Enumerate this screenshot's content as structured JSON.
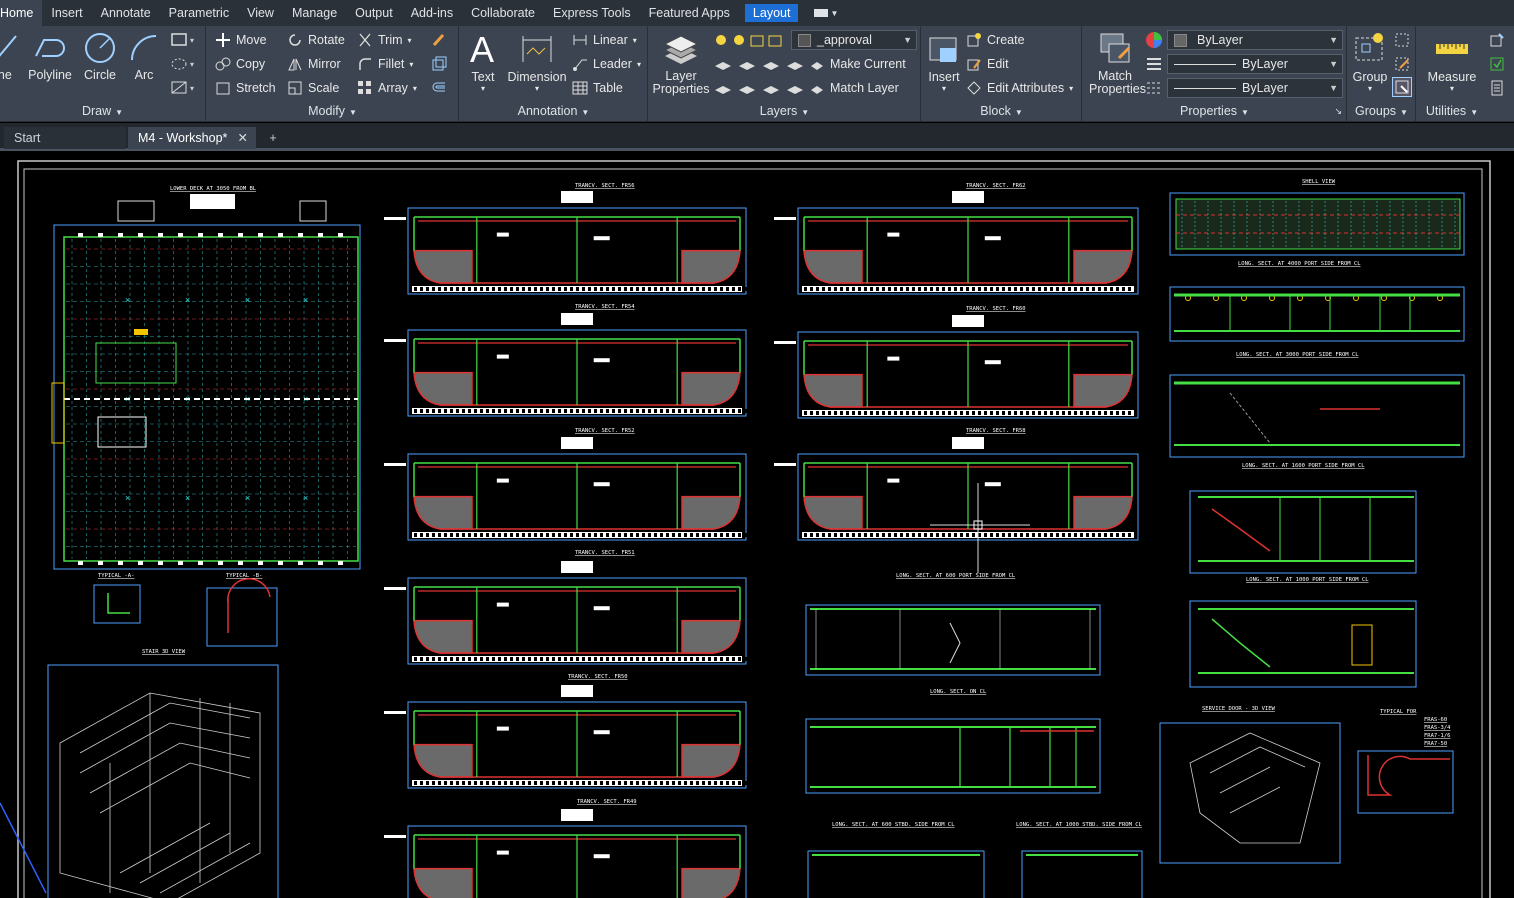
{
  "menu": {
    "tabs": [
      "Home",
      "Insert",
      "Annotate",
      "Parametric",
      "View",
      "Manage",
      "Output",
      "Add-ins",
      "Collaborate",
      "Express Tools",
      "Featured Apps",
      "Layout"
    ]
  },
  "ribbon": {
    "draw": {
      "title": "Draw",
      "line": "Line",
      "polyline": "Polyline",
      "circle": "Circle",
      "arc": "Arc"
    },
    "modify": {
      "title": "Modify",
      "move": "Move",
      "rotate": "Rotate",
      "trim": "Trim",
      "copy": "Copy",
      "mirror": "Mirror",
      "fillet": "Fillet",
      "stretch": "Stretch",
      "scale": "Scale",
      "array": "Array"
    },
    "annotation": {
      "title": "Annotation",
      "text": "Text",
      "dimension": "Dimension",
      "linear": "Linear",
      "leader": "Leader",
      "table": "Table"
    },
    "layers": {
      "title": "Layers",
      "layer_properties": "Layer Properties",
      "current_layer": "_approval",
      "make_current": "Make Current",
      "match_layer": "Match Layer"
    },
    "block": {
      "title": "Block",
      "insert": "Insert",
      "create": "Create",
      "edit": "Edit",
      "edit_attributes": "Edit Attributes"
    },
    "properties": {
      "title": "Properties",
      "match_properties": "Match Properties",
      "color": "ByLayer",
      "linetype": "ByLayer",
      "lineweight": "ByLayer"
    },
    "groups": {
      "title": "Groups",
      "group": "Group"
    },
    "utilities": {
      "title": "Utilities",
      "measure": "Measure"
    }
  },
  "file_tabs": {
    "start": "Start",
    "active": "M4 - Workshop*"
  },
  "drawing": {
    "titles": {
      "lower_deck": "LOWER DECK AT 3050 FROM BL",
      "fr56": "TRANCV. SECT. FR56",
      "fr62": "TRANCV. SECT. FR62",
      "shell_view": "SHELL VIEW",
      "fr54": "TRANCV. SECT. FR54",
      "fr60": "TRANCV. SECT. FR60",
      "long4000": "LONG. SECT. AT 4000 PORT SIDE FROM CL",
      "long3000": "LONG. SECT. AT 3000 PORT SIDE FROM CL",
      "fr52": "TRANCV. SECT. FR52",
      "fr58": "TRANCV. SECT. FR58",
      "long1600": "LONG. SECT. AT 1600 PORT SIDE FROM CL",
      "typical_a": "TYPICAL -A-",
      "typical_b": "TYPICAL -B-",
      "fr51": "TRANCV. SECT. FR51",
      "long600": "LONG. SECT. AT 600 PORT SIDE FROM CL",
      "long1000": "LONG. SECT. AT 1000 PORT SIDE FROM CL",
      "stair3d": "STAIR 3D VIEW",
      "fr50": "TRANCV. SECT. FR50",
      "long_cl": "LONG. SECT. ON CL",
      "service_door": "SERVICE DOOR - 3D VIEW",
      "typical_for": "TYPICAL FOR",
      "fr49": "TRANCV. SECT. FR49",
      "long600stbd": "LONG. SECT. AT 600 STBD. SIDE FROM CL",
      "long1000stbd": "LONG. SECT. AT 1000 STBD. SIDE FROM CL"
    },
    "typical_list": [
      "FRAS-60",
      "FRAS-3/4",
      "FRA7-1/6",
      "FRA7-50"
    ]
  }
}
